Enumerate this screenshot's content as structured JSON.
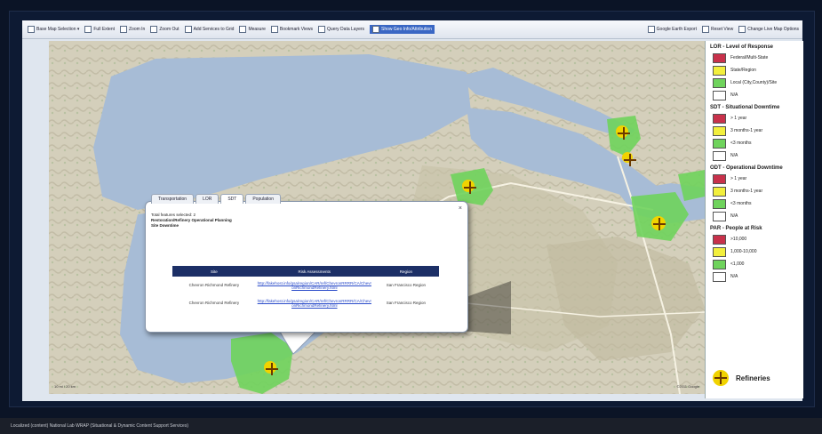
{
  "toolbar": {
    "items": [
      {
        "label": "Base Map Selection ▾",
        "icon": "globe-icon"
      },
      {
        "label": "Full Extent",
        "icon": "extent-icon"
      },
      {
        "label": "Zoom In",
        "icon": "zoom-in-icon"
      },
      {
        "label": "Zoom Out",
        "icon": "zoom-out-icon"
      },
      {
        "label": "Add Services to Grid",
        "icon": "grid-icon"
      },
      {
        "label": "Measure",
        "icon": "ruler-icon"
      },
      {
        "label": "Bookmark Views",
        "icon": "bookmark-icon"
      },
      {
        "label": "Query Data Layers",
        "icon": "query-icon"
      },
      {
        "label": "Show Geo Info/Attribution",
        "icon": "info-icon",
        "active": true
      }
    ],
    "right_items": [
      {
        "label": "Google Earth Export",
        "icon": "export-icon"
      },
      {
        "label": "Reset View",
        "icon": "reset-icon"
      },
      {
        "label": "Change Live Map Options",
        "icon": "options-icon"
      }
    ]
  },
  "legend": {
    "sections": [
      {
        "title": "LOR - Level of Response",
        "items": [
          {
            "label": "Federal/Multi-State",
            "color": "#c8314b"
          },
          {
            "label": "State/Region",
            "color": "#f2ef3d"
          },
          {
            "label": "Local (City,County)/Site",
            "color": "#6fd35c"
          },
          {
            "label": "N/A",
            "color": "#ffffff"
          }
        ]
      },
      {
        "title": "SDT - Situational Downtime",
        "items": [
          {
            "label": "> 1 year",
            "color": "#c8314b"
          },
          {
            "label": "3 months-1 year",
            "color": "#f2ef3d"
          },
          {
            "label": "<3 months",
            "color": "#6fd35c"
          },
          {
            "label": "N/A",
            "color": "#ffffff"
          }
        ]
      },
      {
        "title": "ODT - Operational Downtime",
        "items": [
          {
            "label": "> 1 year",
            "color": "#c8314b"
          },
          {
            "label": "3 months-1 year",
            "color": "#f2ef3d"
          },
          {
            "label": "<3 months",
            "color": "#6fd35c"
          },
          {
            "label": "N/A",
            "color": "#ffffff"
          }
        ]
      },
      {
        "title": "PAR - People at Risk",
        "items": [
          {
            "label": ">10,000",
            "color": "#c8314b"
          },
          {
            "label": "1,000-10,000",
            "color": "#f2ef3d"
          },
          {
            "label": "<1,000",
            "color": "#6fd35c"
          },
          {
            "label": "N/A",
            "color": "#ffffff"
          }
        ]
      }
    ],
    "refineries_label": "Refineries"
  },
  "popup": {
    "tabs": [
      "Transportation",
      "LOR",
      "SDT",
      "Population"
    ],
    "selected_tab": 2,
    "close": "×",
    "header_lines": [
      "Total features selected: 2",
      "Restoration/Refinery Operational Planning",
      "Site Downtime"
    ],
    "table": {
      "columns": [
        "Site",
        "Risk Assessments",
        "Region"
      ],
      "rows": [
        {
          "site": "Chevron Richmond Refinery",
          "link": "http://fakehost.info/gsa/region/CAR/ref/ChevronRRRR/CA/ChevronRichmondRefinery.html",
          "region": "San Francisco Region"
        },
        {
          "site": "Chevron Richmond Refinery",
          "link": "http://fakehost.info/gsa/region/CAR/ref/ChevronRRRR/CA/ChevronRichmondRefinery.html",
          "region": "San Francisco Region"
        }
      ]
    }
  },
  "status_bar": "Localized (content) National Lab WRAP (Situational & Dynamic Content Support Services)",
  "map": {
    "scale": "10 mi / 20 km",
    "copyright": "©2011 Google"
  }
}
